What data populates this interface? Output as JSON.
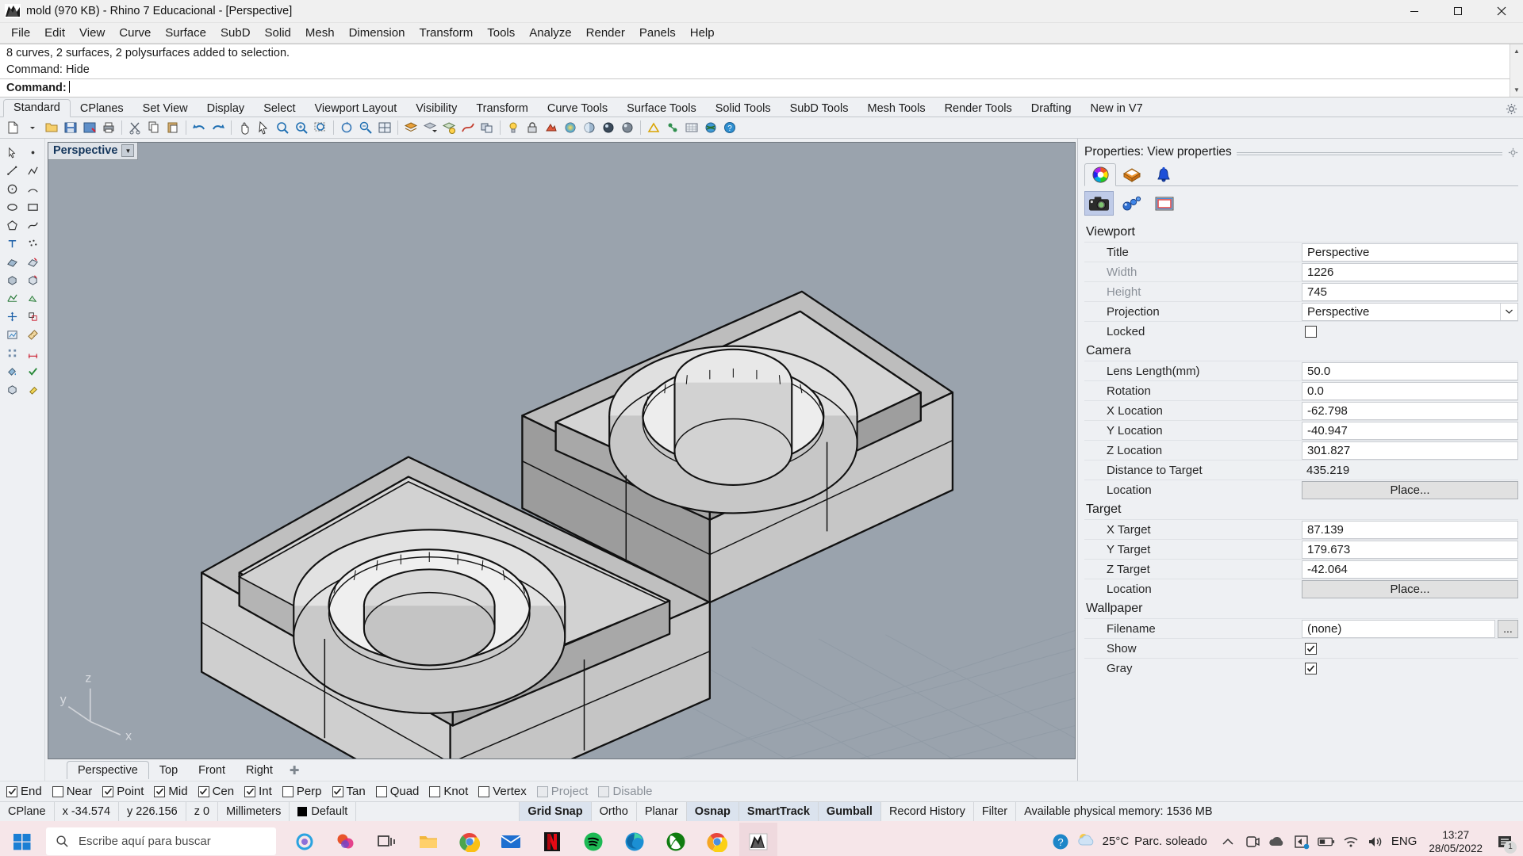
{
  "titlebar": {
    "title": "mold (970 KB) - Rhino 7 Educacional - [Perspective]",
    "minimize_label": "–",
    "maximize_label": "❐",
    "close_label": "✕"
  },
  "menubar": {
    "items": [
      "File",
      "Edit",
      "View",
      "Curve",
      "Surface",
      "SubD",
      "Solid",
      "Mesh",
      "Dimension",
      "Transform",
      "Tools",
      "Analyze",
      "Render",
      "Panels",
      "Help"
    ]
  },
  "command": {
    "history_line_1": "8 curves, 2 surfaces, 2 polysurfaces added to selection.",
    "history_line_2": "Command: Hide",
    "prompt_label": "Command:",
    "input_value": ""
  },
  "toolbar_tabs": {
    "items": [
      "Standard",
      "CPlanes",
      "Set View",
      "Display",
      "Select",
      "Viewport Layout",
      "Visibility",
      "Transform",
      "Curve Tools",
      "Surface Tools",
      "Solid Tools",
      "SubD Tools",
      "Mesh Tools",
      "Render Tools",
      "Drafting",
      "New in V7"
    ],
    "active": "Standard"
  },
  "viewport": {
    "label": "Perspective",
    "dropdown_icon": "chevron-down-icon",
    "axis_labels": {
      "x": "x",
      "y": "y",
      "z": "z"
    },
    "tabs": [
      "Perspective",
      "Top",
      "Front",
      "Right"
    ],
    "active_tab": "Perspective",
    "add_tab_label": "✚"
  },
  "properties": {
    "header": "Properties: View properties",
    "top_tabs": [
      "color-wheel-icon",
      "layers-icon",
      "notification-bell-icon"
    ],
    "sub_tabs": [
      "camera-icon",
      "chain-link-icon",
      "frame-icon"
    ],
    "sub_tab_active": "camera-icon",
    "sections": [
      {
        "title": "Viewport",
        "rows": [
          {
            "key": "Title",
            "value": "Perspective",
            "type": "text",
            "dim": false
          },
          {
            "key": "Width",
            "value": "1226",
            "type": "text",
            "dim": true
          },
          {
            "key": "Height",
            "value": "745",
            "type": "text",
            "dim": true
          },
          {
            "key": "Projection",
            "value": "Perspective",
            "type": "combo",
            "dim": false
          },
          {
            "key": "Locked",
            "value": "",
            "type": "checkbox",
            "checked": false,
            "dim": false
          }
        ]
      },
      {
        "title": "Camera",
        "rows": [
          {
            "key": "Lens Length(mm)",
            "value": "50.0",
            "type": "text",
            "dim": false
          },
          {
            "key": "Rotation",
            "value": "0.0",
            "type": "text",
            "dim": false
          },
          {
            "key": "X Location",
            "value": "-62.798",
            "type": "text",
            "dim": false
          },
          {
            "key": "Y Location",
            "value": "-40.947",
            "type": "text",
            "dim": false
          },
          {
            "key": "Z Location",
            "value": "301.827",
            "type": "text",
            "dim": false
          },
          {
            "key": "Distance to Target",
            "value": "435.219",
            "type": "plain",
            "dim": false
          },
          {
            "key": "Location",
            "value": "Place...",
            "type": "button",
            "dim": false
          }
        ]
      },
      {
        "title": "Target",
        "rows": [
          {
            "key": "X Target",
            "value": "87.139",
            "type": "text",
            "dim": false
          },
          {
            "key": "Y Target",
            "value": "179.673",
            "type": "text",
            "dim": false
          },
          {
            "key": "Z Target",
            "value": "-42.064",
            "type": "text",
            "dim": false
          },
          {
            "key": "Location",
            "value": "Place...",
            "type": "button",
            "dim": false
          }
        ]
      },
      {
        "title": "Wallpaper",
        "rows": [
          {
            "key": "Filename",
            "value": "(none)",
            "type": "file",
            "ellipsis": "...",
            "dim": false
          },
          {
            "key": "Show",
            "value": "",
            "type": "checkbox",
            "checked": true,
            "dim": false
          },
          {
            "key": "Gray",
            "value": "",
            "type": "checkbox",
            "checked": true,
            "dim": false
          }
        ]
      }
    ]
  },
  "osnap": {
    "items": [
      {
        "label": "End",
        "checked": true,
        "enabled": true
      },
      {
        "label": "Near",
        "checked": false,
        "enabled": true
      },
      {
        "label": "Point",
        "checked": true,
        "enabled": true
      },
      {
        "label": "Mid",
        "checked": true,
        "enabled": true
      },
      {
        "label": "Cen",
        "checked": true,
        "enabled": true
      },
      {
        "label": "Int",
        "checked": true,
        "enabled": true
      },
      {
        "label": "Perp",
        "checked": false,
        "enabled": true
      },
      {
        "label": "Tan",
        "checked": true,
        "enabled": true
      },
      {
        "label": "Quad",
        "checked": false,
        "enabled": true
      },
      {
        "label": "Knot",
        "checked": false,
        "enabled": true
      },
      {
        "label": "Vertex",
        "checked": false,
        "enabled": true
      },
      {
        "label": "Project",
        "checked": false,
        "enabled": false
      },
      {
        "label": "Disable",
        "checked": false,
        "enabled": false
      }
    ]
  },
  "statusbar": {
    "cplane": "CPlane",
    "x": "x -34.574",
    "y": "y 226.156",
    "z": "z 0",
    "units": "Millimeters",
    "layer": "Default",
    "layer_color": "#000000",
    "toggles": [
      {
        "label": "Grid Snap",
        "active": true
      },
      {
        "label": "Ortho",
        "active": false
      },
      {
        "label": "Planar",
        "active": false
      },
      {
        "label": "Osnap",
        "active": true
      },
      {
        "label": "SmartTrack",
        "active": true
      },
      {
        "label": "Gumball",
        "active": true
      },
      {
        "label": "Record History",
        "active": false
      },
      {
        "label": "Filter",
        "active": false
      }
    ],
    "memory": "Available physical memory: 1536 MB"
  },
  "taskbar": {
    "start_icon": "windows-start-icon",
    "search_placeholder": "Escribe aquí para buscar",
    "search_icon": "search-icon",
    "taskview_icon": "task-view-icon",
    "apps": [
      {
        "name": "file-explorer-icon"
      },
      {
        "name": "google-chrome-icon"
      },
      {
        "name": "mail-icon"
      },
      {
        "name": "netflix-icon"
      },
      {
        "name": "spotify-icon"
      },
      {
        "name": "microsoft-edge-icon"
      },
      {
        "name": "xbox-icon"
      },
      {
        "name": "chrome-canary-icon"
      },
      {
        "name": "rhino-icon",
        "active": true
      }
    ],
    "help_icon": "help-circle-icon",
    "weather": {
      "icon": "partly-cloudy-icon",
      "temp": "25°C",
      "text": "Parc. soleado"
    },
    "tray": [
      "chevron-up-icon",
      "teams-icon",
      "onedrive-icon",
      "store-icon",
      "battery-icon",
      "wifi-icon",
      "volume-icon"
    ],
    "language": "ENG",
    "time": "13:27",
    "date": "28/05/2022",
    "notification_icon": "notification-icon",
    "notification_count": "1"
  }
}
